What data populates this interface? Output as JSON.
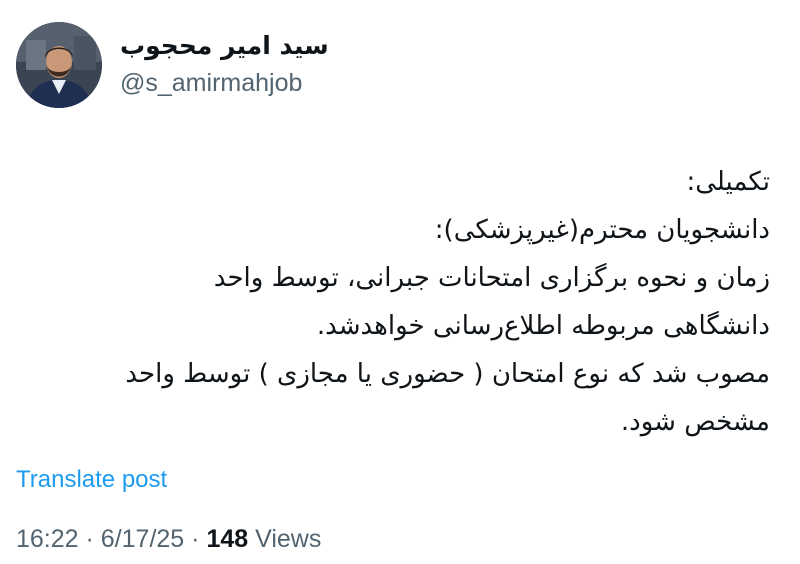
{
  "author": {
    "name": "سید امیر محجوب",
    "handle": "@s_amirmahjob"
  },
  "post": {
    "lines": [
      "تکمیلی:",
      "دانشجویان محترم(غیرپزشکی):",
      "زمان و نحوه برگزاری امتحانات جبرانی، توسط واحد",
      "دانشگاهی مربوطه اطلاع‌رسانی خواهدشد.",
      "مصوب شد که نوع امتحان ( حضوری یا مجازی ) توسط واحد",
      "مشخص شود."
    ],
    "translate_label": "Translate post"
  },
  "meta": {
    "time": "16:22",
    "separator": "·",
    "date": "6/17/25",
    "views_count": "148",
    "views_label": "Views"
  }
}
